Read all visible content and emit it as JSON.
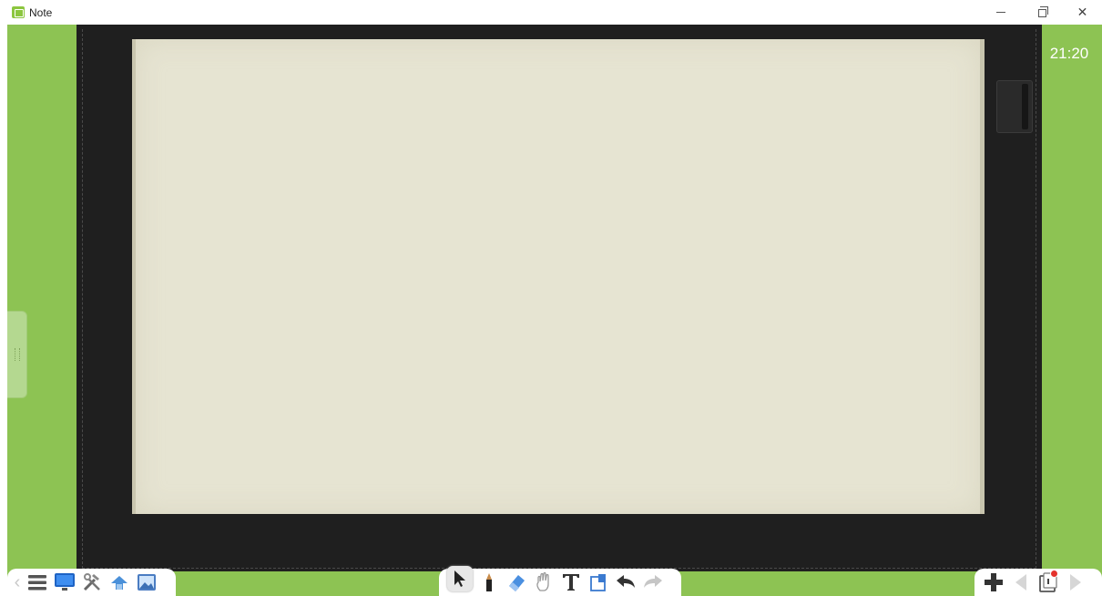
{
  "window": {
    "title": "Note",
    "controls": [
      "minimize",
      "restore",
      "close"
    ]
  },
  "clock": {
    "time": "21:20"
  },
  "colors": {
    "frame_green": "#8dc353",
    "board_dark": "#1f1f1f",
    "paper": "#e6e4d2"
  },
  "toolbars": {
    "left": {
      "icons": [
        "chevron-left-icon",
        "menu-icon",
        "monitor-icon",
        "tools-icon",
        "pan-icon",
        "image-icon"
      ]
    },
    "center": {
      "icons": [
        "cursor-icon",
        "pen-icon",
        "eraser-icon",
        "hand-icon",
        "text-icon",
        "shape-icon",
        "undo-icon",
        "redo-icon"
      ],
      "selected": "cursor-icon"
    },
    "right": {
      "icons": [
        "add-page-icon",
        "prev-page-icon",
        "page-view-icon",
        "next-page-icon"
      ]
    }
  }
}
